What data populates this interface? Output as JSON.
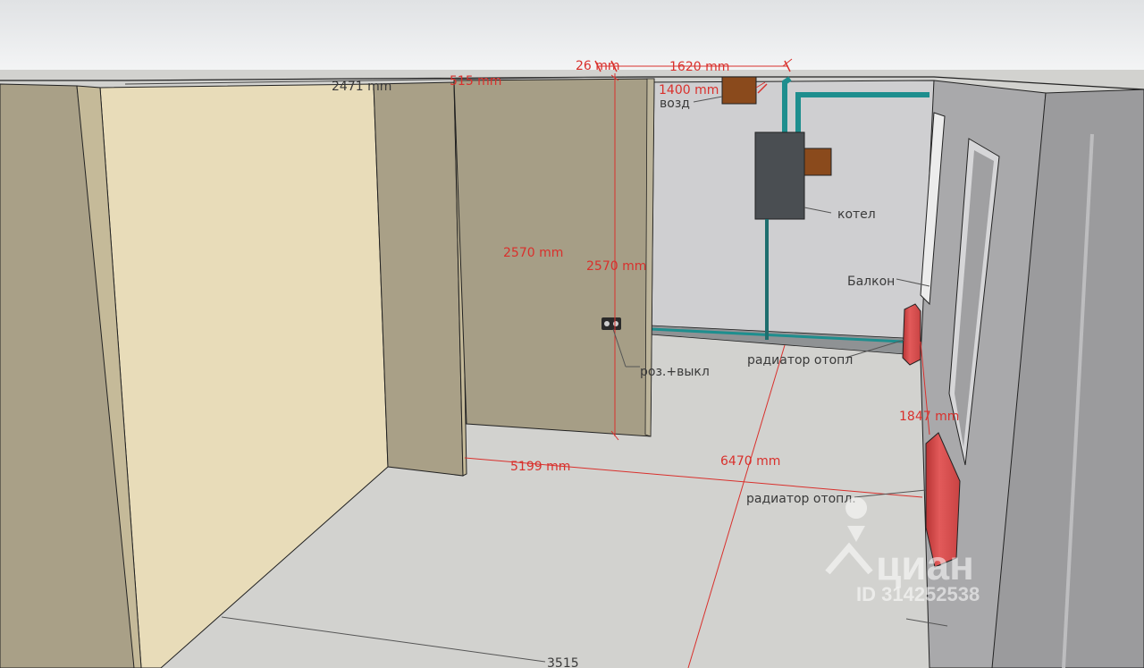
{
  "dimensions": {
    "d_26": "26 mm",
    "d_1620": "1620 mm",
    "d_1400": "1400 mm",
    "d_2471": "2471 mm",
    "d_515": "515 mm",
    "d_2570_a": "2570 mm",
    "d_2570_b": "2570 mm",
    "d_5199": "5199 mm",
    "d_6470": "6470 mm",
    "d_1847": "1847 mm",
    "d_3515": "3515"
  },
  "labels": {
    "air": "возд",
    "boiler": "котел",
    "balcony": "Балкон",
    "outlet": "роз.+выкл",
    "radiator_1": "радиатор отопл",
    "radiator_2": "радиатор отопл."
  },
  "watermark": {
    "brand": "циан",
    "id": "ID 314252538"
  },
  "colors": {
    "sky": "#e9ebec",
    "floor": "#d2d2cf",
    "back_wall": "#cfcfd1",
    "tan_wall": "#a9a087",
    "cream_wall": "#e8dcb9",
    "radiator": "#d84a4a",
    "pipe": "#1e8e8e",
    "dimension": "#d9302c"
  }
}
